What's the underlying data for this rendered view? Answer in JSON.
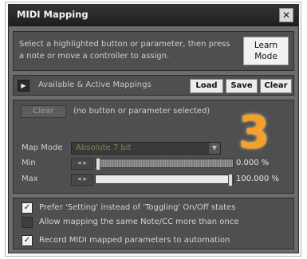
{
  "window": {
    "title": "MIDI Mapping",
    "close_glyph": "✕"
  },
  "info": {
    "instructions": "Select a highlighted button or parameter, then press a note or move a controller to assign.",
    "learn_label": "Learn\nMode"
  },
  "mappings": {
    "label": "Available & Active Mappings",
    "disclosure_glyph": "▶",
    "load": "Load",
    "save": "Save",
    "clear": "Clear"
  },
  "selection": {
    "clear_label": "Clear",
    "status": "(no button or parameter selected)",
    "overlay_number": "3"
  },
  "fields": {
    "map_mode_label": "Map Mode",
    "map_mode_value": "Absolute 7 bit",
    "min_label": "Min",
    "min_value": "0.000 %",
    "min_fraction": 0.0,
    "max_label": "Max",
    "max_value": "100.000 %",
    "max_fraction": 1.0,
    "dropdown_icon": "▼",
    "stepper_icon": "◂ ▸"
  },
  "options": {
    "items": [
      {
        "label": "Prefer 'Setting' instead of 'Toggling' On/Off states",
        "checked": true
      },
      {
        "label": "Allow mapping the same Note/CC more than once",
        "checked": false
      },
      {
        "label": "Record MIDI mapped parameters to automation",
        "checked": true
      }
    ],
    "check_glyph": "✓"
  },
  "colors": {
    "overlay": "#f6a02c",
    "title_bar": "#262626",
    "panel": "#4f4f4f"
  }
}
